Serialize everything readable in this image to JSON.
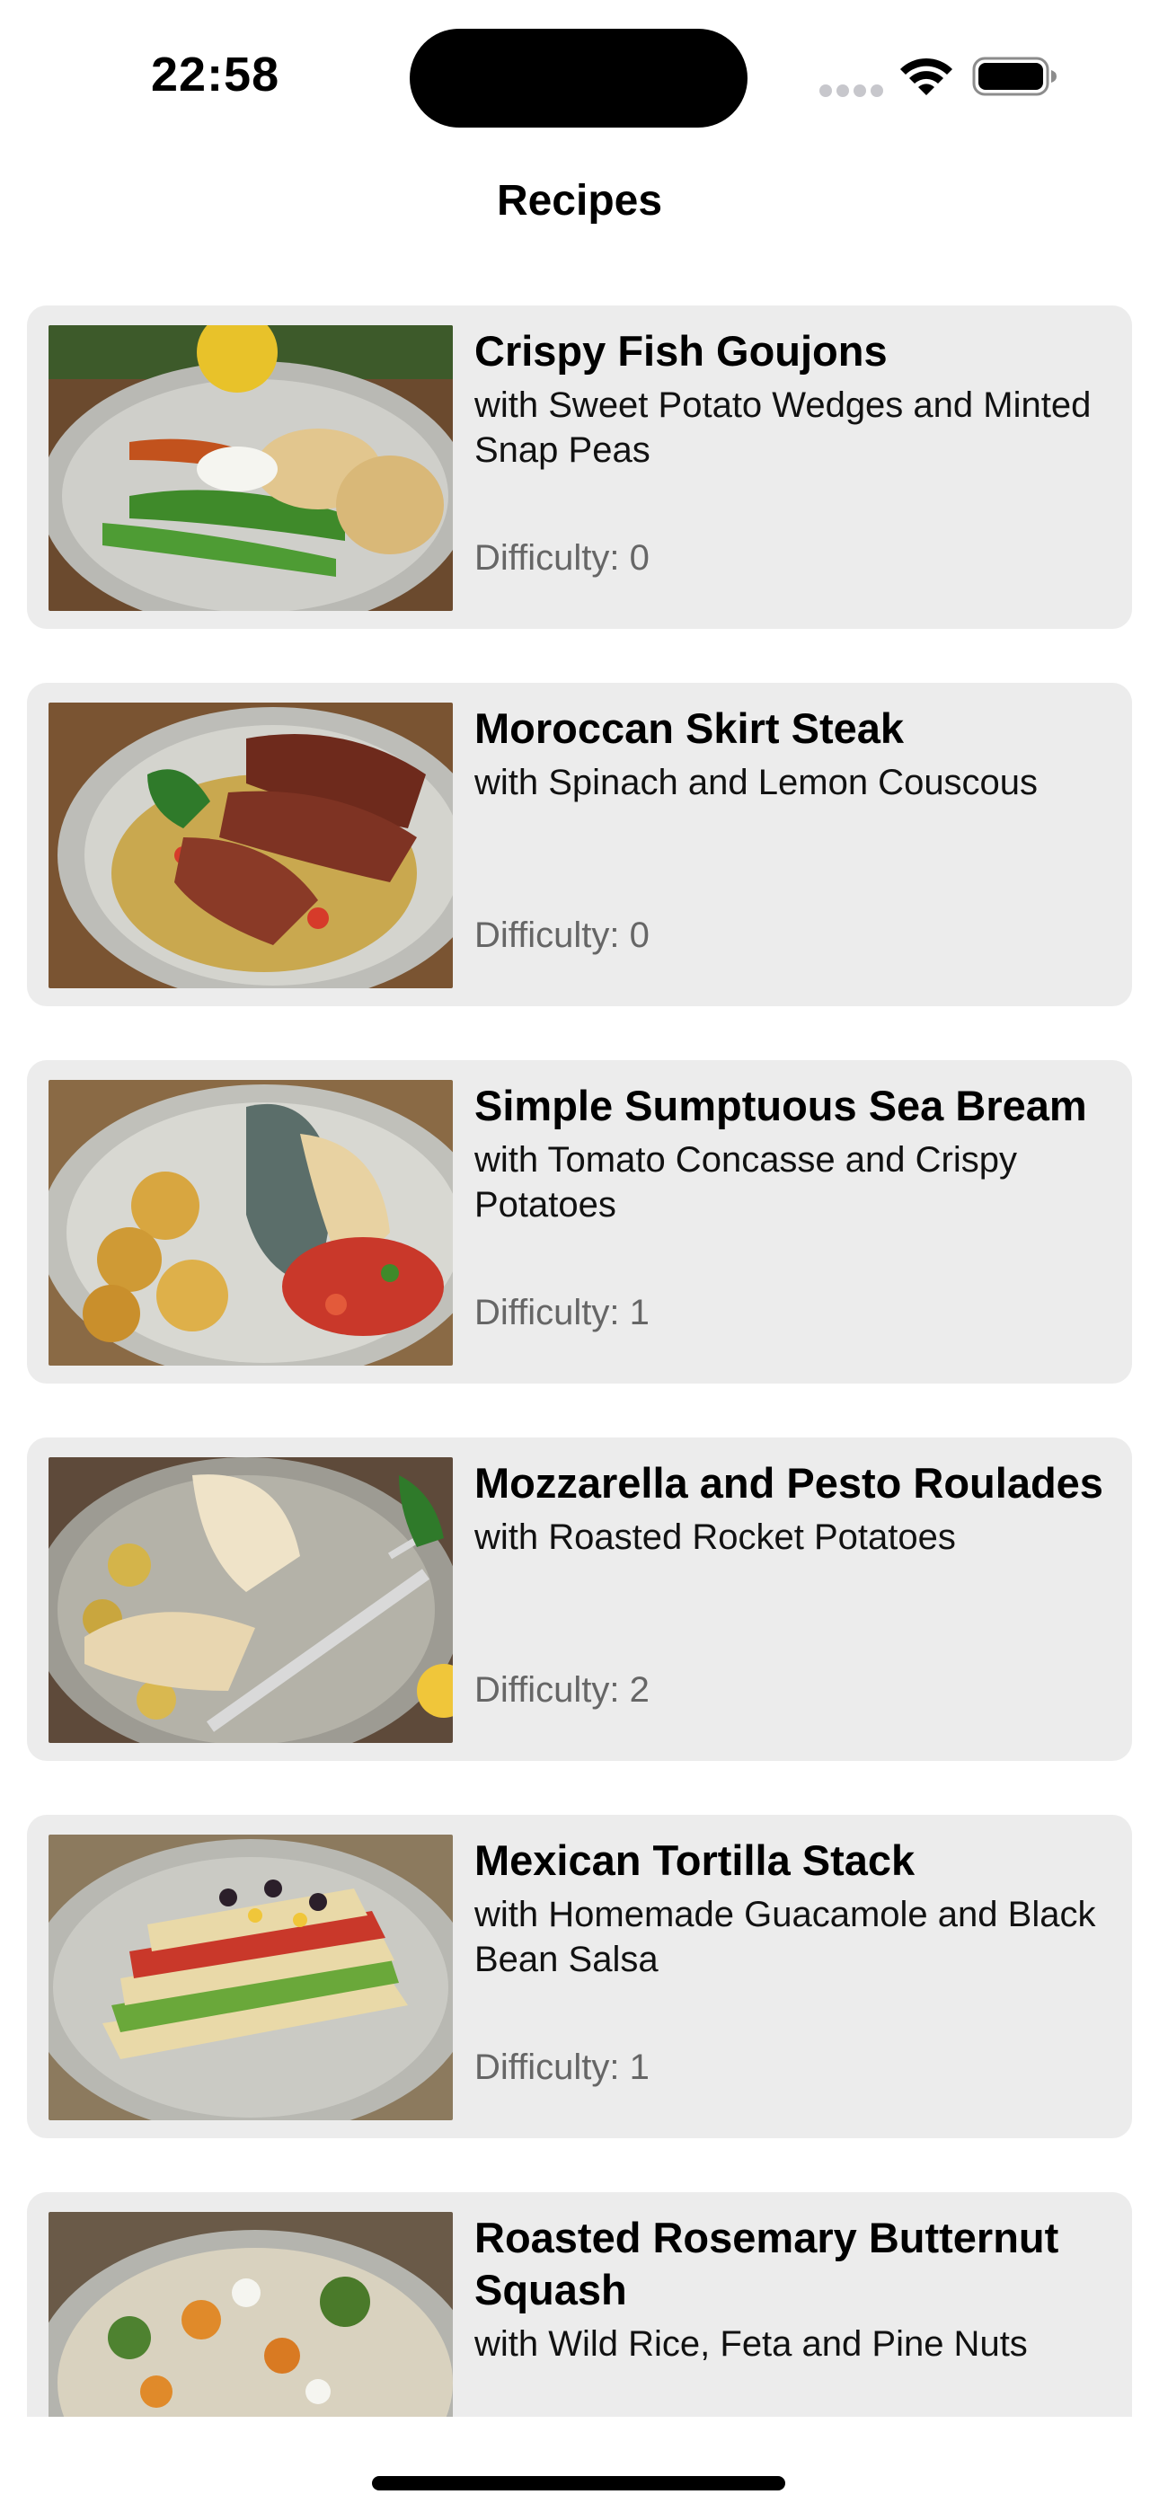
{
  "status_bar": {
    "time": "22:58",
    "icons": [
      "cellular-signal-icon",
      "wifi-icon",
      "battery-icon"
    ]
  },
  "nav": {
    "title": "Recipes"
  },
  "difficulty_label": "Difficulty:",
  "recipes": [
    {
      "title": "Crispy Fish Goujons",
      "subtitle": "with Sweet Potato Wedges and Minted Snap Peas",
      "difficulty": "0"
    },
    {
      "title": "Moroccan Skirt Steak",
      "subtitle": "with Spinach and Lemon Couscous",
      "difficulty": "0"
    },
    {
      "title": "Simple Sumptuous Sea Bream",
      "subtitle": "with Tomato Concasse and Crispy Potatoes",
      "difficulty": "1"
    },
    {
      "title": "Mozzarella and Pesto Roulades",
      "subtitle": "with Roasted Rocket Potatoes",
      "difficulty": "2"
    },
    {
      "title": "Mexican Tortilla Stack",
      "subtitle": "with Homemade Guacamole and Black Bean Salsa",
      "difficulty": "1"
    },
    {
      "title": "Roasted Rosemary Butternut Squash",
      "subtitle": "with Wild Rice, Feta and Pine Nuts",
      "difficulty": ""
    }
  ],
  "colors": {
    "card_background": "#ececec",
    "difficulty_text": "#666666",
    "page_background": "#ffffff"
  }
}
